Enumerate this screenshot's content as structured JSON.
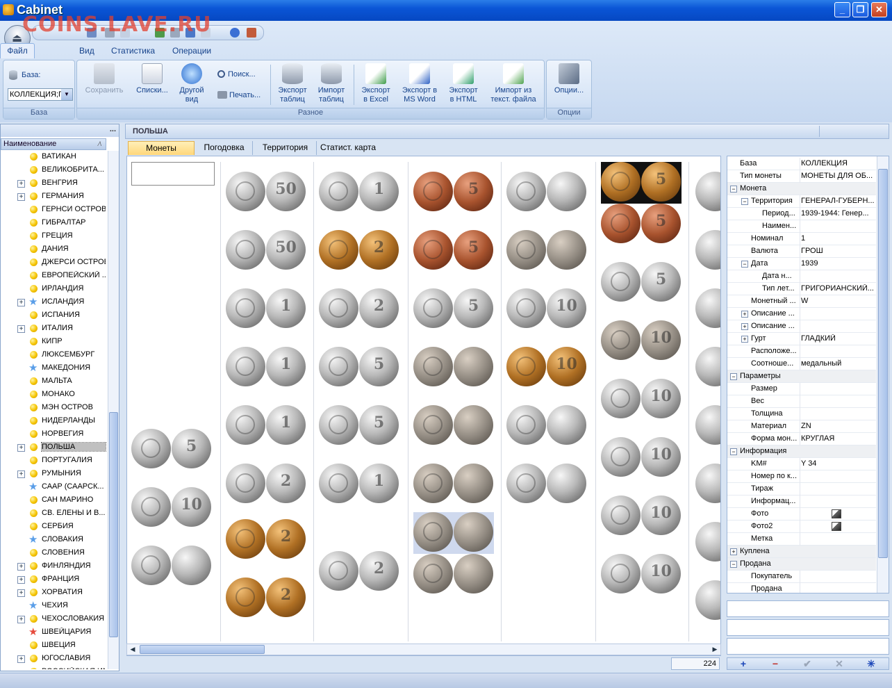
{
  "window": {
    "title": "Cabinet",
    "watermark": "COINS.LAVE.RU",
    "min": "_",
    "max": "❐",
    "close": "✕"
  },
  "ribbon": {
    "tabs": [
      "Файл",
      "Вид",
      "Статистика",
      "Операции"
    ],
    "groups": {
      "base": {
        "caption": "База",
        "label": "База:",
        "combo_value": "КОЛЛЕКЦИЯ;Г"
      },
      "misc": {
        "caption": "Разное",
        "save": "Сохранить",
        "lists": "Списки...",
        "other_view": [
          "Другой",
          "вид"
        ],
        "search": "Поиск...",
        "print": "Печать...",
        "export_tables": [
          "Экспорт",
          "таблиц"
        ],
        "import_tables": [
          "Импорт",
          "таблиц"
        ],
        "export_excel": [
          "Экспорт",
          "в Excel"
        ],
        "export_word": [
          "Экспорт в",
          "MS Word"
        ],
        "export_html": [
          "Экспорт",
          "в HTML"
        ],
        "import_text": [
          "Импорт из",
          "текст. файла"
        ]
      },
      "options": {
        "caption": "Опции",
        "options": "Опции..."
      }
    }
  },
  "left": {
    "column_header": "Наименование",
    "more": "...",
    "items": [
      {
        "label": "ВАТИКАН",
        "icon": "dot",
        "exp": false
      },
      {
        "label": "ВЕЛИКОБРИТА...",
        "icon": "dot",
        "exp": false
      },
      {
        "label": "ВЕНГРИЯ",
        "icon": "dot",
        "exp": true
      },
      {
        "label": "ГЕРМАНИЯ",
        "icon": "dot",
        "exp": true
      },
      {
        "label": "ГЕРНСИ ОСТРОВ",
        "icon": "dot",
        "exp": false
      },
      {
        "label": "ГИБРАЛТАР",
        "icon": "dot",
        "exp": false
      },
      {
        "label": "ГРЕЦИЯ",
        "icon": "dot",
        "exp": false
      },
      {
        "label": "ДАНИЯ",
        "icon": "dot",
        "exp": false
      },
      {
        "label": "ДЖЕРСИ ОСТРОВ",
        "icon": "dot",
        "exp": false
      },
      {
        "label": "ЕВРОПЕЙСКИЙ ...",
        "icon": "dot",
        "exp": false
      },
      {
        "label": "ИРЛАНДИЯ",
        "icon": "dot",
        "exp": false
      },
      {
        "label": "ИСЛАНДИЯ",
        "icon": "star",
        "exp": true
      },
      {
        "label": "ИСПАНИЯ",
        "icon": "dot",
        "exp": false
      },
      {
        "label": "ИТАЛИЯ",
        "icon": "dot",
        "exp": true
      },
      {
        "label": "КИПР",
        "icon": "dot",
        "exp": false
      },
      {
        "label": "ЛЮКСЕМБУРГ",
        "icon": "dot",
        "exp": false
      },
      {
        "label": "МАКЕДОНИЯ",
        "icon": "star",
        "exp": false
      },
      {
        "label": "МАЛЬТА",
        "icon": "dot",
        "exp": false
      },
      {
        "label": "МОНАКО",
        "icon": "dot",
        "exp": false
      },
      {
        "label": "МЭН ОСТРОВ",
        "icon": "dot",
        "exp": false
      },
      {
        "label": "НИДЕРЛАНДЫ",
        "icon": "dot",
        "exp": false
      },
      {
        "label": "НОРВЕГИЯ",
        "icon": "dot",
        "exp": false
      },
      {
        "label": "ПОЛЬША",
        "icon": "dot",
        "exp": true,
        "selected": true
      },
      {
        "label": "ПОРТУГАЛИЯ",
        "icon": "dot",
        "exp": false
      },
      {
        "label": "РУМЫНИЯ",
        "icon": "dot",
        "exp": true
      },
      {
        "label": "СААР (СААРСК...",
        "icon": "star",
        "exp": false
      },
      {
        "label": "САН МАРИНО",
        "icon": "dot",
        "exp": false
      },
      {
        "label": "СВ. ЕЛЕНЫ И В...",
        "icon": "dot",
        "exp": false
      },
      {
        "label": "СЕРБИЯ",
        "icon": "dot",
        "exp": false
      },
      {
        "label": "СЛОВАКИЯ",
        "icon": "star",
        "exp": false
      },
      {
        "label": "СЛОВЕНИЯ",
        "icon": "dot",
        "exp": false
      },
      {
        "label": "ФИНЛЯНДИЯ",
        "icon": "dot",
        "exp": true
      },
      {
        "label": "ФРАНЦИЯ",
        "icon": "dot",
        "exp": true
      },
      {
        "label": "ХОРВАТИЯ",
        "icon": "dot",
        "exp": true
      },
      {
        "label": "ЧЕХИЯ",
        "icon": "star",
        "exp": false
      },
      {
        "label": "ЧЕХОСЛОВАКИЯ",
        "icon": "dot",
        "exp": true
      },
      {
        "label": "ШВЕЙЦАРИЯ",
        "icon": "redstar",
        "exp": false
      },
      {
        "label": "ШВЕЦИЯ",
        "icon": "dot",
        "exp": false
      },
      {
        "label": "ЮГОСЛАВИЯ",
        "icon": "dot",
        "exp": true
      },
      {
        "label": "РОССИЙСКАЯ ИМП...",
        "icon": "dot",
        "exp": false
      }
    ]
  },
  "main": {
    "title": "ПОЛЬША",
    "tabs": [
      "Монеты",
      "Погодовка",
      "Территория",
      "Статист. карта"
    ],
    "count": "224"
  },
  "gallery": {
    "columns": [
      [
        {
          "m": "silver",
          "d": "5"
        },
        {
          "m": "silver",
          "d": "10"
        },
        {
          "m": "silver",
          "d": ""
        }
      ],
      [
        {
          "m": "silver",
          "d": "50"
        },
        {
          "m": "silver",
          "d": "50"
        },
        {
          "m": "silver",
          "d": "1"
        },
        {
          "m": "silver",
          "d": "1"
        },
        {
          "m": "silver",
          "d": "1"
        },
        {
          "m": "silver",
          "d": "2"
        },
        {
          "m": "bronze",
          "d": "2"
        },
        {
          "m": "bronze",
          "d": "2"
        }
      ],
      [
        {
          "m": "silver",
          "d": "1"
        },
        {
          "m": "bronze",
          "d": "2"
        },
        {
          "m": "silver",
          "d": "2"
        },
        {
          "m": "silver",
          "d": "5"
        },
        {
          "m": "silver",
          "d": "5"
        },
        {
          "m": "silver",
          "d": "1"
        },
        {
          "m": "silver",
          "d": "2"
        }
      ],
      [
        {
          "m": "copper",
          "d": "5"
        },
        {
          "m": "copper",
          "d": "5"
        },
        {
          "m": "silver",
          "d": "5"
        },
        {
          "m": "dark",
          "d": ""
        },
        {
          "m": "dark",
          "d": ""
        },
        {
          "m": "dark",
          "d": ""
        },
        {
          "m": "dark",
          "d": "",
          "bg": "blue"
        },
        {
          "m": "dark",
          "d": ""
        }
      ],
      [
        {
          "m": "silver",
          "d": ""
        },
        {
          "m": "dark",
          "d": ""
        },
        {
          "m": "silver",
          "d": "10"
        },
        {
          "m": "bronze",
          "d": "10"
        },
        {
          "m": "silver",
          "d": ""
        },
        {
          "m": "silver",
          "d": ""
        }
      ],
      [
        {
          "m": "bronze",
          "d": "5",
          "bg": "boxed"
        },
        {
          "m": "copper",
          "d": "5"
        },
        {
          "m": "silver",
          "d": "5"
        },
        {
          "m": "dark",
          "d": "10"
        },
        {
          "m": "silver",
          "d": "10"
        },
        {
          "m": "silver",
          "d": "10"
        },
        {
          "m": "silver",
          "d": "10"
        },
        {
          "m": "silver",
          "d": "10"
        }
      ]
    ]
  },
  "props": {
    "rows": [
      {
        "k": "База",
        "v": "КОЛЛЕКЦИЯ",
        "lvl": 0
      },
      {
        "k": "Тип монеты",
        "v": "МОНЕТЫ ДЛЯ ОБ...",
        "lvl": 0
      },
      {
        "k": "Монета",
        "v": "",
        "lvl": 0,
        "cat": true,
        "exp": "−"
      },
      {
        "k": "Территория",
        "v": "ГЕНЕРАЛ-ГУБЕРН...",
        "lvl": 1,
        "exp": "−"
      },
      {
        "k": "Период...",
        "v": "1939-1944: Генер...",
        "lvl": 2
      },
      {
        "k": "Наимен...",
        "v": "",
        "lvl": 2
      },
      {
        "k": "Номинал",
        "v": "1",
        "lvl": 1
      },
      {
        "k": "Валюта",
        "v": "ГРОШ",
        "lvl": 1
      },
      {
        "k": "Дата",
        "v": "1939",
        "lvl": 1,
        "exp": "−"
      },
      {
        "k": "Дата н...",
        "v": "",
        "lvl": 2
      },
      {
        "k": "Тип лет...",
        "v": "ГРИГОРИАНСКИЙ...",
        "lvl": 2
      },
      {
        "k": "Монетный ...",
        "v": "W",
        "lvl": 1
      },
      {
        "k": "Описание ...",
        "v": "",
        "lvl": 1,
        "exp": "+"
      },
      {
        "k": "Описание ...",
        "v": "",
        "lvl": 1,
        "exp": "+"
      },
      {
        "k": "Гурт",
        "v": "ГЛАДКИЙ",
        "lvl": 1,
        "exp": "+"
      },
      {
        "k": "Расположе...",
        "v": "",
        "lvl": 1
      },
      {
        "k": "Соотноше...",
        "v": "медальный",
        "lvl": 1
      },
      {
        "k": "Параметры",
        "v": "",
        "lvl": 0,
        "cat": true,
        "exp": "−"
      },
      {
        "k": "Размер",
        "v": "",
        "lvl": 1
      },
      {
        "k": "Вес",
        "v": "",
        "lvl": 1
      },
      {
        "k": "Толщина",
        "v": "",
        "lvl": 1
      },
      {
        "k": "Материал",
        "v": "ZN",
        "lvl": 1
      },
      {
        "k": "Форма мон...",
        "v": "КРУГЛАЯ",
        "lvl": 1
      },
      {
        "k": "Информация",
        "v": "",
        "lvl": 0,
        "cat": true,
        "exp": "−"
      },
      {
        "k": "KM#",
        "v": "Y 34",
        "lvl": 1
      },
      {
        "k": "Номер по к...",
        "v": "",
        "lvl": 1
      },
      {
        "k": "Тираж",
        "v": "",
        "lvl": 1
      },
      {
        "k": "Информац...",
        "v": "",
        "lvl": 1
      },
      {
        "k": "Фото",
        "v": "",
        "lvl": 1,
        "pic": true
      },
      {
        "k": "Фото2",
        "v": "",
        "lvl": 1,
        "pic": true
      },
      {
        "k": "Метка",
        "v": "",
        "lvl": 1
      },
      {
        "k": "Куплена",
        "v": "",
        "lvl": 0,
        "cat": true,
        "exp": "+"
      },
      {
        "k": "Продана",
        "v": "",
        "lvl": 0,
        "cat": true,
        "exp": "−"
      },
      {
        "k": "Покупатель",
        "v": "",
        "lvl": 1
      },
      {
        "k": "Продана",
        "v": "",
        "lvl": 1
      }
    ]
  },
  "navbar": {
    "add": "+",
    "delete": "−",
    "apply": "✔",
    "cancel": "✕",
    "refresh": "✳"
  }
}
